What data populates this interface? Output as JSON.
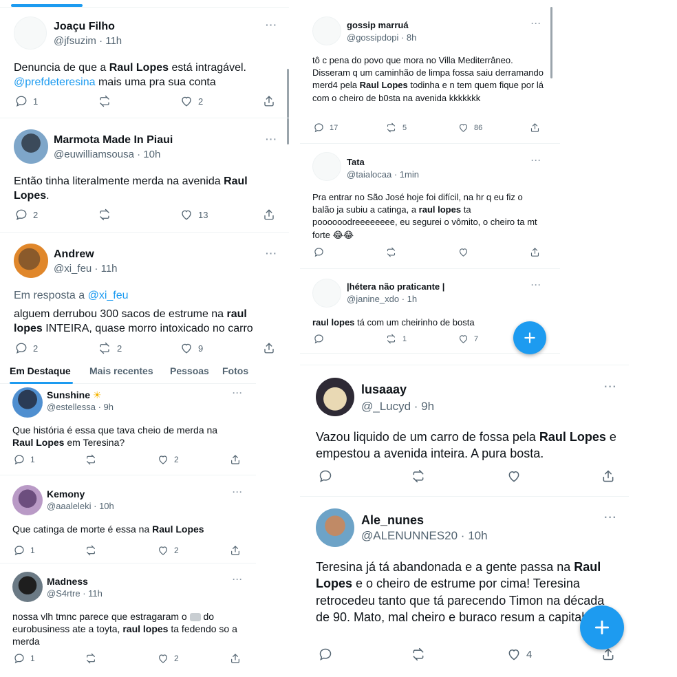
{
  "panel_a": {
    "tweets": [
      {
        "name": "Joaçu Filho",
        "handle": "@jfsuzim · 11h",
        "more": "···",
        "text_pre": "Denuncia de que a ",
        "text_bold": "Raul Lopes",
        "text_post": " está intragável.",
        "mention": "@prefdeteresina",
        "text_post2": " mais uma pra sua conta",
        "reply_count": "1",
        "retweet_count": "",
        "like_count": "2"
      },
      {
        "name": "Marmota Made In Piaui",
        "handle": "@euwilliamsousa · 10h",
        "more": "···",
        "text_pre": "Então tinha literalmente merda na avenida ",
        "text_bold": "Raul Lopes",
        "text_post": ".",
        "reply_count": "2",
        "retweet_count": "",
        "like_count": "13"
      },
      {
        "name": "Andrew",
        "handle": "@xi_feu · 11h",
        "more": "···",
        "reply_prefix": "Em resposta a ",
        "reply_mention": "@xi_feu",
        "text_pre": "alguem derrubou 300 sacos de estrume na ",
        "text_bold": "raul lopes",
        "text_post": " INTEIRA, quase morro intoxicado no carro",
        "reply_count": "2",
        "retweet_count": "2",
        "like_count": "9"
      }
    ]
  },
  "tabs": {
    "items": [
      "Em Destaque",
      "Mais recentes",
      "Pessoas",
      "Fotos"
    ],
    "active": "Em Destaque"
  },
  "panel_b": {
    "tweets": [
      {
        "name": "Sunshine",
        "name_emoji": "☀",
        "handle": "@estellessa · 9h",
        "more": "···",
        "text_pre": "Que história é essa que tava cheio de merda na ",
        "text_bold": "Raul Lopes",
        "text_post": " em Teresina?",
        "reply_count": "1",
        "like_count": "2"
      },
      {
        "name": "Kemony",
        "handle": "@aaaleleki · 10h",
        "more": "···",
        "text_pre": "Que catinga de morte é essa na ",
        "text_bold": "Raul Lopes",
        "text_post": "",
        "reply_count": "1",
        "like_count": "2"
      },
      {
        "name": "Madness",
        "handle": "@S4rtre · 11h",
        "more": "···",
        "text_pre": "nossa vlh tmnc parece que estragaram o ",
        "text_mid": " do eurobusiness ate a toyta, ",
        "text_bold": "raul lopes",
        "text_post": " ta fedendo so a merda",
        "reply_count": "1",
        "like_count": "2"
      }
    ]
  },
  "panel_c": {
    "tweets": [
      {
        "name": "gossip marruá",
        "handle": "@gossipdopi · 8h",
        "more": "···",
        "text_pre": "tô c pena do povo que mora no Villa Mediterrâneo. Disseram q um caminhão de limpa fossa saiu derramando merd4 pela ",
        "text_bold": "Raul Lopes",
        "text_post": " todinha e n tem quem fique por lá com o cheiro de b0sta na avenida kkkkkkk",
        "reply_count": "17",
        "retweet_count": "5",
        "like_count": "86"
      },
      {
        "name": "Tata",
        "handle": "@taialocaa · 1min",
        "more": "···",
        "text_pre": "Pra entrar no São José hoje foi difícil, na hr q eu fiz o balão ja subiu a catinga, a ",
        "text_bold": "raul lopes",
        "text_post": " ta poooooodreeeeeeee, eu segurei o vômito, o cheiro ta mt forte 😂😂",
        "reply_count": "",
        "retweet_count": "",
        "like_count": ""
      },
      {
        "name": "|hétera não praticante |",
        "handle": "@janine_xdo · 1h",
        "more": "···",
        "text_pre": "",
        "text_bold": "raul lopes",
        "text_post": " tá com um cheirinho de bosta",
        "reply_count": "",
        "retweet_count": "1",
        "like_count": "7"
      }
    ]
  },
  "panel_d": {
    "tweets": [
      {
        "name": "lusaaay",
        "handle": "@_Lucyd · 9h",
        "more": "···",
        "text_pre": "Vazou liquido de um carro de fossa pela ",
        "text_bold": "Raul Lopes",
        "text_post": " e empestou a avenida inteira. A pura bosta.",
        "reply_count": "",
        "like_count": ""
      },
      {
        "name": "Ale_nunes",
        "handle": "@ALENUNNES20 · 10h",
        "more": "···",
        "text_pre": "Teresina já tá abandonada e a gente passa na ",
        "text_bold": "Raul Lopes",
        "text_post": " e o cheiro de estrume por cima! Teresina retrocedeu tanto que tá parecendo Timon na década de 90. Mato, mal cheiro e buraco resum a capital.",
        "reply_count": "",
        "like_count": "4"
      }
    ]
  },
  "colors": {
    "accent": "#1d9bf0",
    "text": "#0f1419",
    "muted": "#536471",
    "divider": "#eff3f4"
  }
}
